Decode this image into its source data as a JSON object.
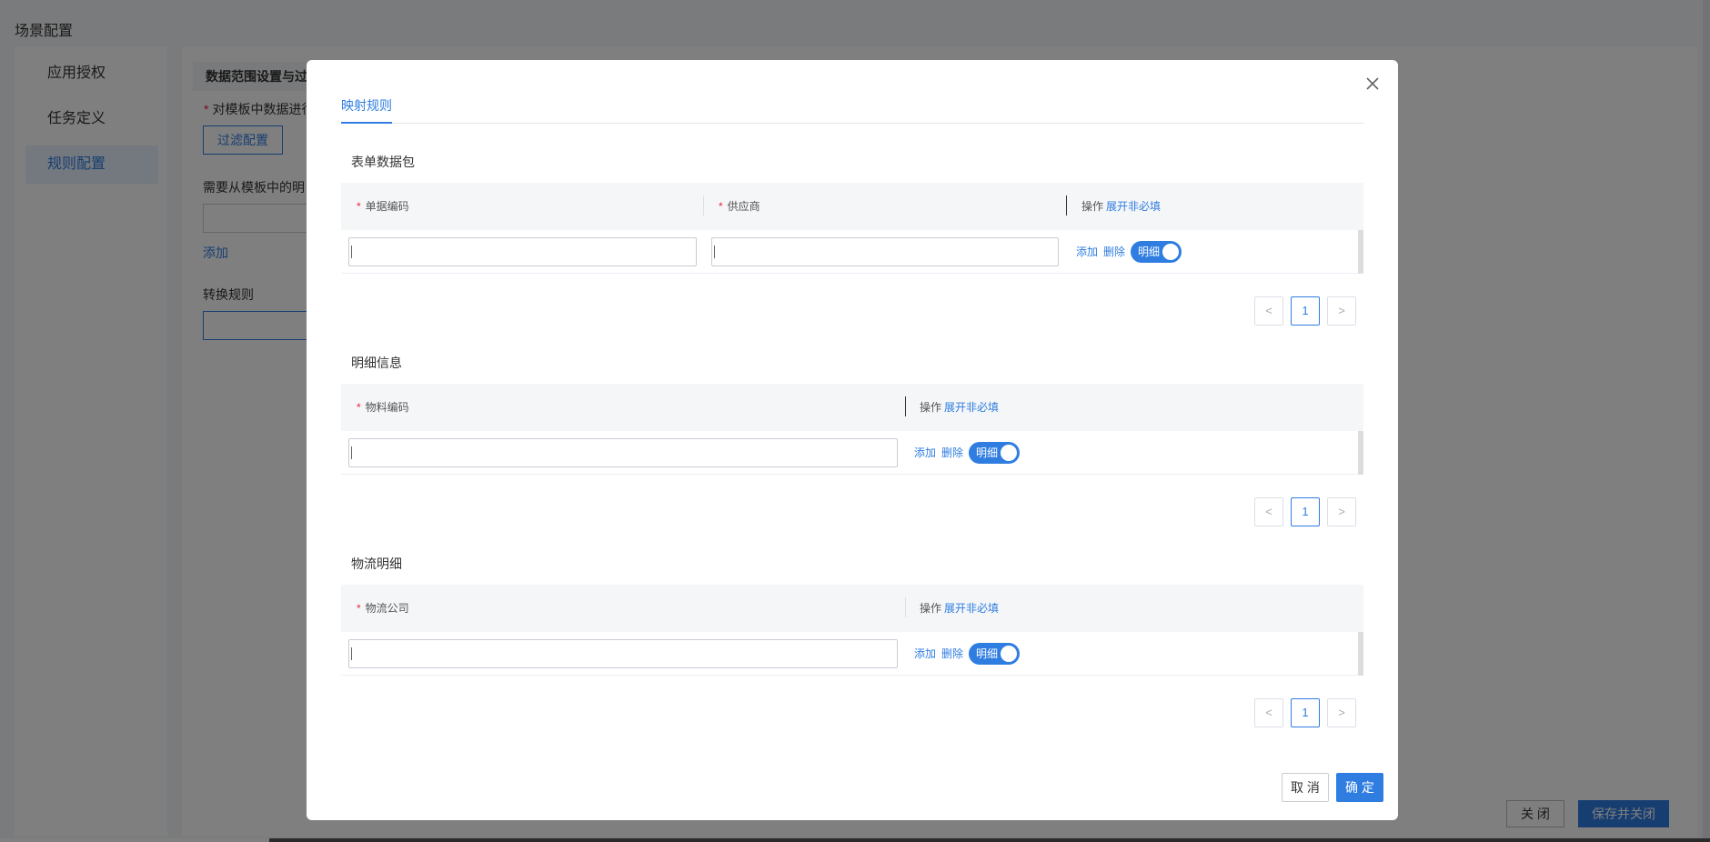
{
  "page": {
    "title": "场景配置",
    "sidebar": {
      "items": [
        "应用授权",
        "任务定义",
        "规则配置"
      ],
      "active_index": 2
    },
    "main": {
      "section_header": "数据范围设置与过",
      "required_label": "对模板中数据进行",
      "filter_button": "过滤配置",
      "detail_label": "需要从模板中的明",
      "add_link": "添加",
      "convert_label": "转换规则"
    },
    "footer": {
      "close": "关 闭",
      "save_close": "保存并关闭"
    }
  },
  "modal": {
    "tab": "映射规则",
    "sections": [
      {
        "title": "表单数据包",
        "columns": [
          "单据编码",
          "供应商"
        ],
        "op_label": "操作",
        "op_link": "展开非必填",
        "row": {
          "add": "添加",
          "delete": "删除",
          "toggle_label": "明细",
          "toggle_on": true
        },
        "page": "1"
      },
      {
        "title": "明细信息",
        "columns": [
          "物料编码"
        ],
        "op_label": "操作",
        "op_link": "展开非必填",
        "row": {
          "add": "添加",
          "delete": "删除",
          "toggle_label": "明细",
          "toggle_on": true
        },
        "page": "1"
      },
      {
        "title": "物流明细",
        "columns": [
          "物流公司"
        ],
        "op_label": "操作",
        "op_link": "展开非必填",
        "row": {
          "add": "添加",
          "delete": "删除",
          "toggle_label": "明细",
          "toggle_on": true
        },
        "page": "1"
      }
    ],
    "buttons": {
      "cancel": "取 消",
      "ok": "确 定"
    }
  },
  "colors": {
    "accent": "#2f7de1",
    "required": "#ee2244"
  }
}
